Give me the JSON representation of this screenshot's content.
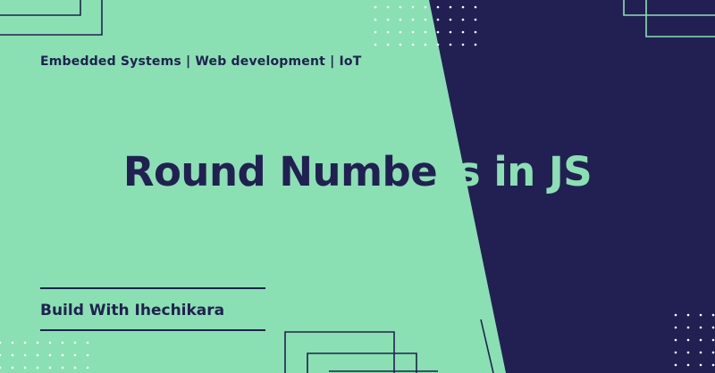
{
  "colors": {
    "mint": "#8ae0b2",
    "navy": "#222052"
  },
  "tagline": "Embedded Systems | Web development | IoT",
  "title": {
    "part_dark": "Round Numbe",
    "part_light": "rs in JS"
  },
  "author": "Build With Ihechikara"
}
